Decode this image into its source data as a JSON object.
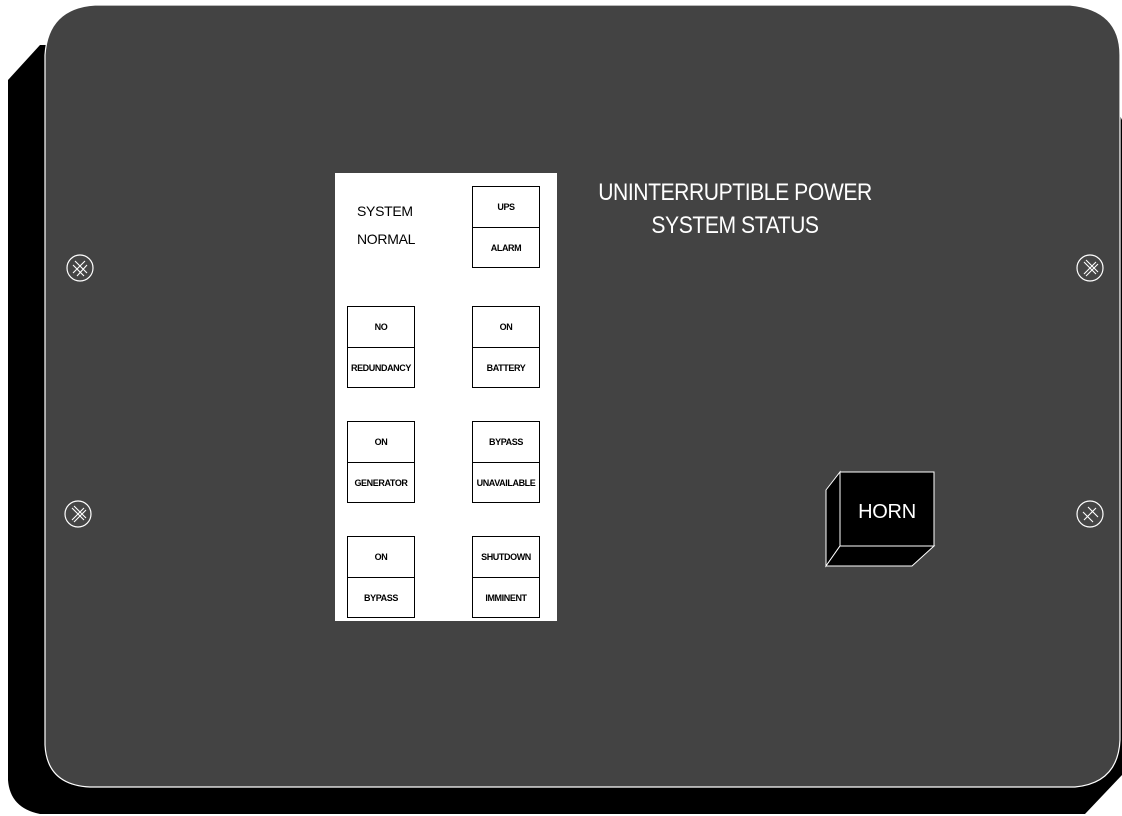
{
  "panel": {
    "title_line_1": "UNINTERRUPTIBLE POWER",
    "title_line_2": "SYSTEM STATUS",
    "face_color": "#434343",
    "shadow_color": "#000000",
    "outline_color": "#ffffff"
  },
  "indicators": {
    "system_normal": {
      "line_1": "SYSTEM",
      "line_2": "NORMAL"
    },
    "ups_alarm": {
      "top": "UPS",
      "bottom": "ALARM"
    },
    "no_redundancy": {
      "top": "NO",
      "bottom": "REDUNDANCY"
    },
    "on_battery": {
      "top": "ON",
      "bottom": "BATTERY"
    },
    "on_generator": {
      "top": "ON",
      "bottom": "GENERATOR"
    },
    "bypass_unavailable": {
      "top": "BYPASS",
      "bottom": "UNAVAILABLE"
    },
    "on_bypass": {
      "top": "ON",
      "bottom": "BYPASS"
    },
    "shutdown_imminent": {
      "top": "SHUTDOWN",
      "bottom": "IMMINENT"
    }
  },
  "horn_button": {
    "label": "HORN"
  },
  "screws": [
    "screw-icon",
    "screw-icon",
    "screw-icon",
    "screw-icon"
  ]
}
